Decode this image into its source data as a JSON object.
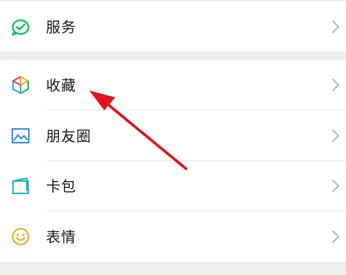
{
  "menu": {
    "group1": [
      {
        "label": "服务",
        "icon": "service-check-icon"
      }
    ],
    "group2": [
      {
        "label": "收藏",
        "icon": "favorites-cube-icon"
      },
      {
        "label": "朋友圈",
        "icon": "moments-image-icon"
      },
      {
        "label": "卡包",
        "icon": "card-wallet-icon"
      },
      {
        "label": "表情",
        "icon": "sticker-smile-icon"
      }
    ]
  },
  "colors": {
    "green": "#07c160",
    "annotation_arrow": "#e0151b",
    "chevron": "#b2b2b2",
    "background": "#ededed"
  },
  "annotation": {
    "type": "arrow",
    "target": "收藏"
  }
}
